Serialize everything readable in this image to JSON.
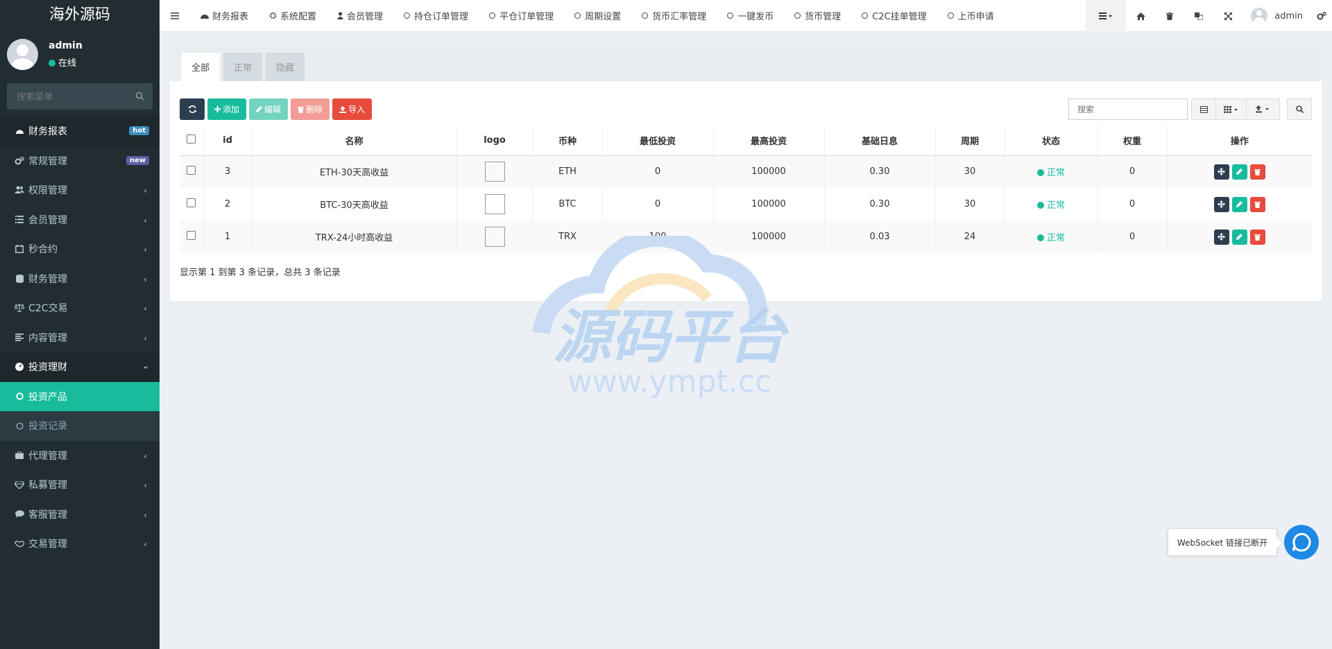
{
  "sidebar": {
    "logo": "海外源码",
    "user": {
      "name": "admin",
      "status": "在线"
    },
    "search_placeholder": "搜索菜单",
    "items": [
      {
        "label": "财务报表",
        "badge": "hot"
      },
      {
        "label": "常规管理",
        "badge": "new"
      },
      {
        "label": "权限管理"
      },
      {
        "label": "会员管理"
      },
      {
        "label": "秒合约"
      },
      {
        "label": "财务管理"
      },
      {
        "label": "C2C交易"
      },
      {
        "label": "内容管理"
      },
      {
        "label": "投资理财"
      },
      {
        "label": "投资产品"
      },
      {
        "label": "投资记录"
      },
      {
        "label": "代理管理"
      },
      {
        "label": "私募管理"
      },
      {
        "label": "客服管理"
      },
      {
        "label": "交易管理"
      }
    ]
  },
  "topnav": {
    "items": [
      "财务报表",
      "系统配置",
      "会员管理",
      "持仓订单管理",
      "平仓订单管理",
      "周期设置",
      "货币汇率管理",
      "一键发币",
      "货币管理",
      "C2C挂单管理",
      "上币申请"
    ],
    "admin": "admin"
  },
  "tabs": [
    "全部",
    "正常",
    "隐藏"
  ],
  "toolbar": {
    "add": "添加",
    "edit": "编辑",
    "delete": "删除",
    "import": "导入"
  },
  "search_placeholder": "搜索",
  "table": {
    "headers": [
      "id",
      "名称",
      "logo",
      "币种",
      "最低投资",
      "最高投资",
      "基础日息",
      "周期",
      "状态",
      "权重",
      "操作"
    ],
    "rows": [
      {
        "id": "3",
        "name": "ETH-30天高收益",
        "coin": "ETH",
        "min": "0",
        "max": "100000",
        "rate": "0.30",
        "period": "30",
        "status": "正常",
        "weight": "0"
      },
      {
        "id": "2",
        "name": "BTC-30天高收益",
        "coin": "BTC",
        "min": "0",
        "max": "100000",
        "rate": "0.30",
        "period": "30",
        "status": "正常",
        "weight": "0"
      },
      {
        "id": "1",
        "name": "TRX-24小时高收益",
        "coin": "TRX",
        "min": "100",
        "max": "100000",
        "rate": "0.03",
        "period": "24",
        "status": "正常",
        "weight": "0"
      }
    ]
  },
  "pagination_text": "显示第 1 到第 3 条记录，总共 3 条记录",
  "watermark": {
    "title": "源码平台",
    "url": "www.ympt.cc"
  },
  "websocket_text": "WebSocket 链接已断开",
  "colors": {
    "sidebar": "#222d32",
    "accent": "#18bc9c",
    "danger": "#e74c3c",
    "dark": "#2c3e50"
  }
}
